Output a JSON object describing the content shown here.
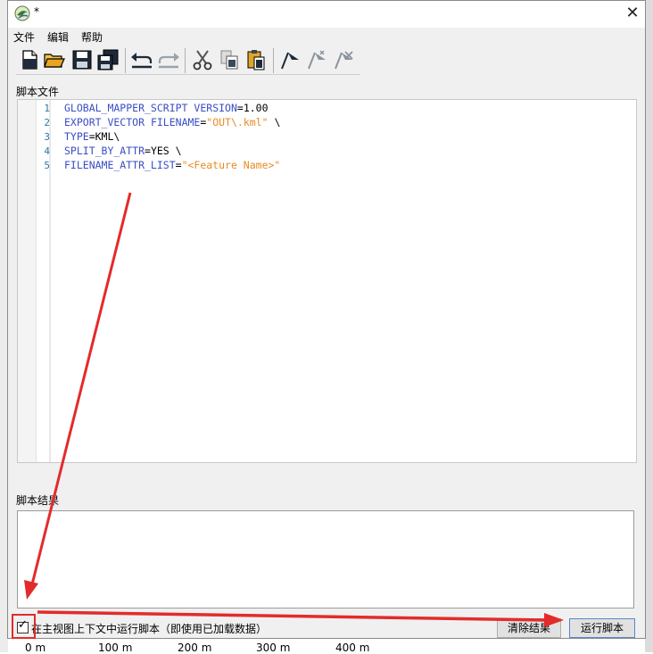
{
  "window": {
    "title": "*",
    "close_glyph": "✕",
    "app_icon": "globe-icon"
  },
  "menu": {
    "items": [
      "文件",
      "编辑",
      "帮助"
    ]
  },
  "toolbar": {
    "buttons": [
      "new-file-icon",
      "open-folder-icon",
      "save-icon",
      "save-all-icon",
      "undo-icon",
      "redo-icon",
      "cut-icon",
      "copy-icon",
      "paste-icon",
      "run-flag-icon",
      "step-flag-icon",
      "stop-flag-icon"
    ]
  },
  "script": {
    "label": "脚本文件",
    "line_numbers": [
      "1",
      "2",
      "3",
      "4",
      "5"
    ],
    "lines": [
      [
        {
          "t": "GLOBAL_MAPPER_SCRIPT",
          "c": "kw"
        },
        {
          "t": " ",
          "c": "op"
        },
        {
          "t": "VERSION",
          "c": "kw"
        },
        {
          "t": "=1.00",
          "c": "op"
        }
      ],
      [
        {
          "t": "EXPORT_VECTOR",
          "c": "kw"
        },
        {
          "t": " ",
          "c": "op"
        },
        {
          "t": "FILENAME",
          "c": "kw"
        },
        {
          "t": "=",
          "c": "op"
        },
        {
          "t": "\"OUT\\.kml\"",
          "c": "str"
        },
        {
          "t": " \\",
          "c": "op"
        }
      ],
      [
        {
          "t": "TYPE",
          "c": "kw"
        },
        {
          "t": "=KML\\",
          "c": "op"
        }
      ],
      [
        {
          "t": "SPLIT_BY_ATTR",
          "c": "kw"
        },
        {
          "t": "=YES \\",
          "c": "op"
        }
      ],
      [
        {
          "t": "FILENAME_ATTR_LIST",
          "c": "kw"
        },
        {
          "t": "=",
          "c": "op"
        },
        {
          "t": "\"<Feature Name>\"",
          "c": "str"
        }
      ]
    ]
  },
  "results": {
    "label": "脚本结果",
    "content": ""
  },
  "footer": {
    "checkbox_label": "在主视图上下文中运行脚本（即使用已加载数据）",
    "checkbox_checked": true,
    "check_glyph": "✓",
    "clear_button": "清除结果",
    "run_button": "运行脚本"
  },
  "ruler": {
    "labels": [
      "0 m",
      "100 m",
      "200 m",
      "300 m",
      "400 m"
    ]
  },
  "colors": {
    "keyword": "#3b4ec4",
    "string": "#e88b23",
    "line_number": "#2b7aa8",
    "annotation": "#e32b2b"
  }
}
